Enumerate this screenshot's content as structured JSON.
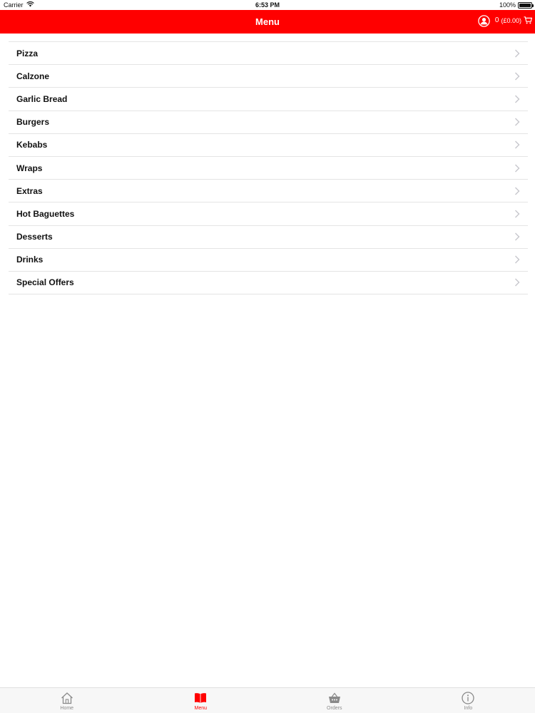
{
  "status_bar": {
    "carrier": "Carrier",
    "time": "6:53 PM",
    "battery": "100%"
  },
  "nav": {
    "title": "Menu",
    "cart_count": "0",
    "cart_total": "(£0.00)"
  },
  "menu_items": [
    {
      "label": "Pizza"
    },
    {
      "label": "Calzone"
    },
    {
      "label": "Garlic Bread"
    },
    {
      "label": "Burgers"
    },
    {
      "label": "Kebabs"
    },
    {
      "label": "Wraps"
    },
    {
      "label": "Extras"
    },
    {
      "label": "Hot Baguettes"
    },
    {
      "label": "Desserts"
    },
    {
      "label": "Drinks"
    },
    {
      "label": "Special Offers"
    }
  ],
  "tabs": [
    {
      "label": "Home",
      "icon": "home-icon",
      "active": false
    },
    {
      "label": "Menu",
      "icon": "menu-book-icon",
      "active": true
    },
    {
      "label": "Orders",
      "icon": "basket-icon",
      "active": false
    },
    {
      "label": "Info",
      "icon": "info-icon",
      "active": false
    }
  ],
  "colors": {
    "brand_red": "#ff0000",
    "tab_inactive": "#8a8a8a"
  }
}
